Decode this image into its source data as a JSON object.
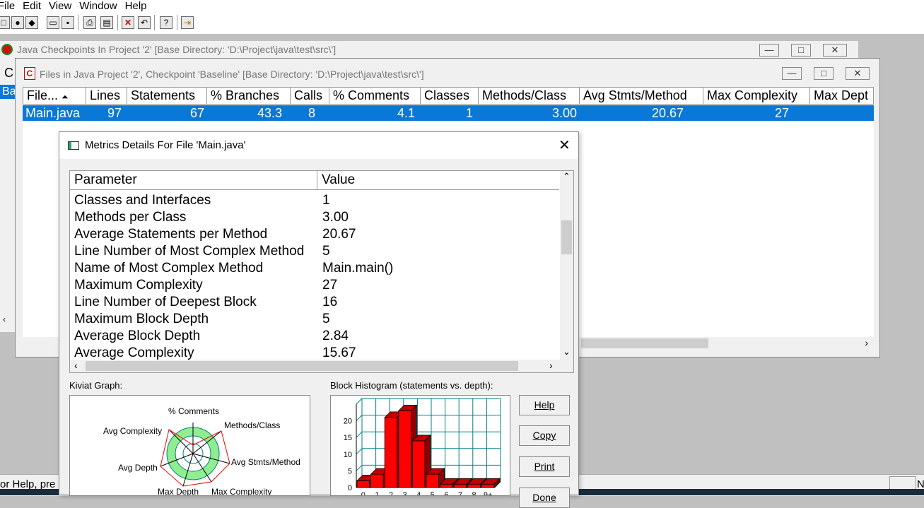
{
  "menu": [
    "File",
    "Edit",
    "View",
    "Window",
    "Help"
  ],
  "back_window": {
    "title": "Java Checkpoints In Project '2'  [Base Directory: 'D:\\Project\\java\\test\\src\\']",
    "col_c": "C",
    "col_b": "Ba"
  },
  "files_window": {
    "title": "Files in Java Project '2', Checkpoint 'Baseline'  [Base Directory: 'D:\\Project\\java\\test\\src\\']",
    "columns": [
      "File...",
      "Lines",
      "Statements",
      "% Branches",
      "Calls",
      "% Comments",
      "Classes",
      "Methods/Class",
      "Avg Stmts/Method",
      "Max Complexity",
      "Max Dept"
    ],
    "row": [
      "Main.java",
      "97",
      "67",
      "43.3",
      "8",
      "4.1",
      "1",
      "3.00",
      "20.67",
      "27",
      ""
    ]
  },
  "dialog": {
    "title": "Metrics Details For File 'Main.java'",
    "table_header": {
      "parameter": "Parameter",
      "value": "Value"
    },
    "rows": [
      {
        "parameter": "Classes and Interfaces",
        "value": "1"
      },
      {
        "parameter": "Methods per Class",
        "value": "3.00"
      },
      {
        "parameter": "Average Statements per Method",
        "value": "20.67"
      },
      {
        "parameter": "Line Number of Most Complex Method",
        "value": "5"
      },
      {
        "parameter": "Name of Most Complex Method",
        "value": "Main.main()"
      },
      {
        "parameter": "Maximum Complexity",
        "value": "27"
      },
      {
        "parameter": "Line Number of Deepest Block",
        "value": "16"
      },
      {
        "parameter": "Maximum Block Depth",
        "value": "5"
      },
      {
        "parameter": "Average Block Depth",
        "value": "2.84"
      },
      {
        "parameter": "Average Complexity",
        "value": "15.67"
      }
    ],
    "kiviat_label": "Kiviat Graph:",
    "kiviat_axes": [
      "% Comments",
      "Methods/Class",
      "Avg Stmts/Method",
      "Max Complexity",
      "Max Depth",
      "Avg Depth",
      "Avg Complexity"
    ],
    "histogram_label": "Block Histogram (statements vs. depth):",
    "buttons": {
      "help": "Help",
      "copy": "Copy",
      "print": "Print",
      "done": "Done"
    }
  },
  "chart_data": {
    "type": "bar",
    "title": "Block Histogram (statements vs. depth):",
    "categories": [
      "0",
      "1",
      "2",
      "3",
      "4",
      "5",
      "6",
      "7",
      "8",
      "9+"
    ],
    "values": [
      2,
      4,
      21,
      23,
      14,
      4,
      1,
      1,
      1,
      1
    ],
    "yticks": [
      "0",
      "5",
      "10",
      "15",
      "20"
    ],
    "ylim": [
      0,
      25
    ],
    "grid": true,
    "bar_color": "#ff0000"
  },
  "status": {
    "text": "or Help, pre",
    "right": "N"
  },
  "colors": {
    "selection": "#0a78d7",
    "bar": "#ff0000",
    "kiviat_fill": "#90ee90",
    "grid": "#008080"
  }
}
